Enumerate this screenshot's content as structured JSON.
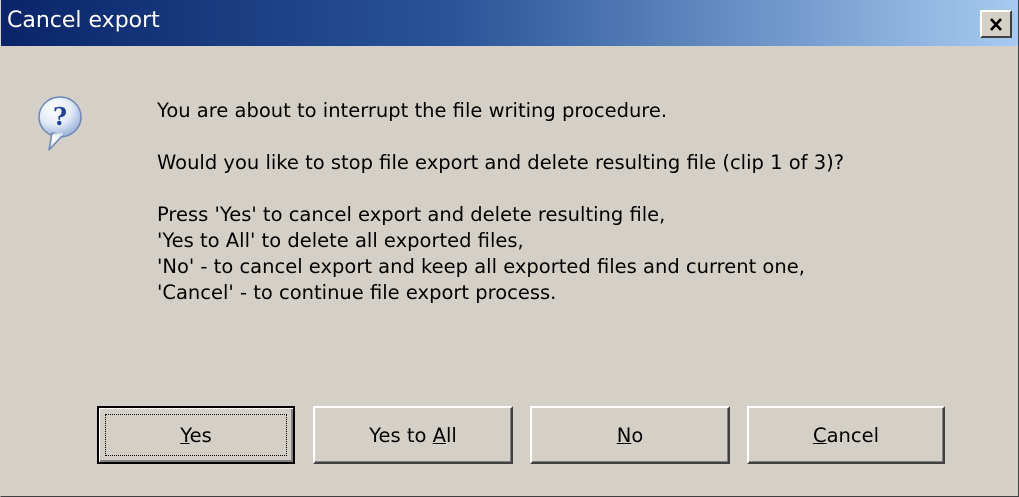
{
  "window": {
    "title": "Cancel export",
    "close_glyph": "✕"
  },
  "icon": {
    "name": "question-icon",
    "glyph": "?"
  },
  "message": {
    "line1": "You are about to interrupt the file writing procedure.",
    "line2": "Would you like to stop file export and delete resulting file (clip 1 of 3)?",
    "line3": "Press 'Yes' to cancel export and delete resulting file,",
    "line4": "'Yes to All' to delete all exported files,",
    "line5": "'No' - to cancel export and keep all exported files and current one,",
    "line6": "'Cancel' - to continue file export process."
  },
  "buttons": {
    "yes": {
      "pre": "",
      "accel": "Y",
      "post": "es"
    },
    "yes_to_all": {
      "pre": "Yes to ",
      "accel": "A",
      "post": "ll"
    },
    "no": {
      "pre": "",
      "accel": "N",
      "post": "o"
    },
    "cancel": {
      "pre": "",
      "accel": "C",
      "post": "ancel"
    }
  },
  "colors": {
    "titlebar_start": "#0a246a",
    "titlebar_end": "#a6caf0",
    "face": "#d4d0c8"
  }
}
